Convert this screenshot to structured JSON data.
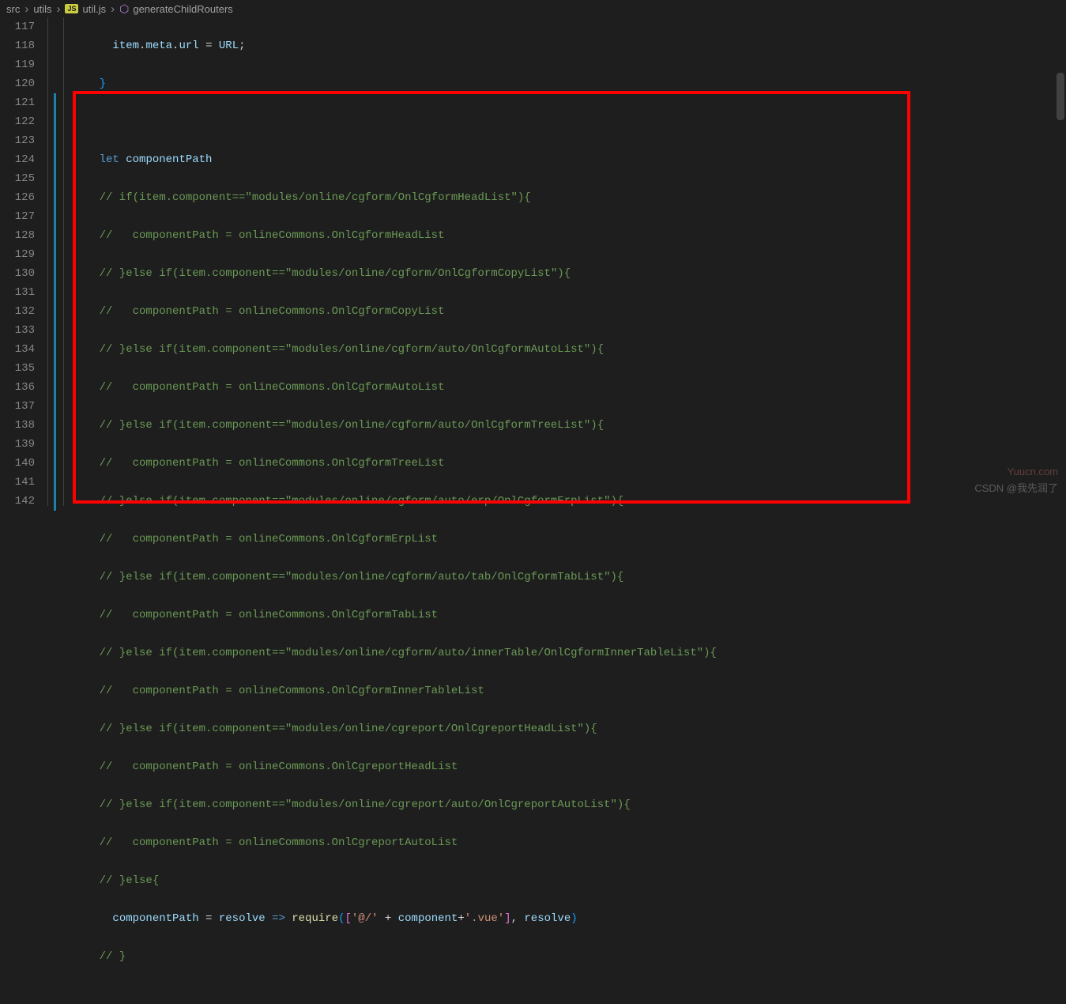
{
  "breadcrumbs": {
    "item1": "src",
    "item2": "utils",
    "badge": "JS",
    "item3": "util.js",
    "item4": "generateChildRouters"
  },
  "lineNumbers": [
    "117",
    "118",
    "119",
    "120",
    "121",
    "122",
    "123",
    "124",
    "125",
    "126",
    "127",
    "128",
    "129",
    "130",
    "131",
    "132",
    "133",
    "134",
    "135",
    "136",
    "137",
    "138",
    "139",
    "140",
    "141",
    "142"
  ],
  "code": {
    "l117": {
      "indent": "      ",
      "t1": "item",
      "t2": ".",
      "t3": "meta",
      "t4": ".",
      "t5": "url",
      "t6": " = ",
      "t7": "URL",
      "t8": ";"
    },
    "l118": {
      "indent": "    ",
      "brace": "}"
    },
    "l119": "",
    "l120": {
      "indent": "    ",
      "kw": "let",
      "sp": " ",
      "var": "componentPath"
    },
    "l121": "    // if(item.component==\"modules/online/cgform/OnlCgformHeadList\"){",
    "l122": "    //   componentPath = onlineCommons.OnlCgformHeadList",
    "l123": "    // }else if(item.component==\"modules/online/cgform/OnlCgformCopyList\"){",
    "l124": "    //   componentPath = onlineCommons.OnlCgformCopyList",
    "l125": "    // }else if(item.component==\"modules/online/cgform/auto/OnlCgformAutoList\"){",
    "l126": "    //   componentPath = onlineCommons.OnlCgformAutoList",
    "l127": "    // }else if(item.component==\"modules/online/cgform/auto/OnlCgformTreeList\"){",
    "l128": "    //   componentPath = onlineCommons.OnlCgformTreeList",
    "l129": "    // }else if(item.component==\"modules/online/cgform/auto/erp/OnlCgformErpList\"){",
    "l130": "    //   componentPath = onlineCommons.OnlCgformErpList",
    "l131": "    // }else if(item.component==\"modules/online/cgform/auto/tab/OnlCgformTabList\"){",
    "l132": "    //   componentPath = onlineCommons.OnlCgformTabList",
    "l133": "    // }else if(item.component==\"modules/online/cgform/auto/innerTable/OnlCgformInnerTableList\"){",
    "l134": "    //   componentPath = onlineCommons.OnlCgformInnerTableList",
    "l135": "    // }else if(item.component==\"modules/online/cgreport/OnlCgreportHeadList\"){",
    "l136": "    //   componentPath = onlineCommons.OnlCgreportHeadList",
    "l137": "    // }else if(item.component==\"modules/online/cgreport/auto/OnlCgreportAutoList\"){",
    "l138": "    //   componentPath = onlineCommons.OnlCgreportAutoList",
    "l139": "    // }else{",
    "l140": {
      "indent": "      ",
      "var": "componentPath",
      "eq": " = ",
      "p1": "resolve",
      "ar": " => ",
      "fn": "require",
      "po": "(",
      "bo": "[",
      "s1": "'@/'",
      "pl": " + ",
      "p2": "component",
      "pl2": "+",
      "s2": "'.vue'",
      "bc": "]",
      "cm": ", ",
      "p3": "resolve",
      "pc": ")"
    },
    "l141": "    // }"
  },
  "watermarks": {
    "w1": "Yuucn.com",
    "w2": "CSDN @我先润了"
  }
}
